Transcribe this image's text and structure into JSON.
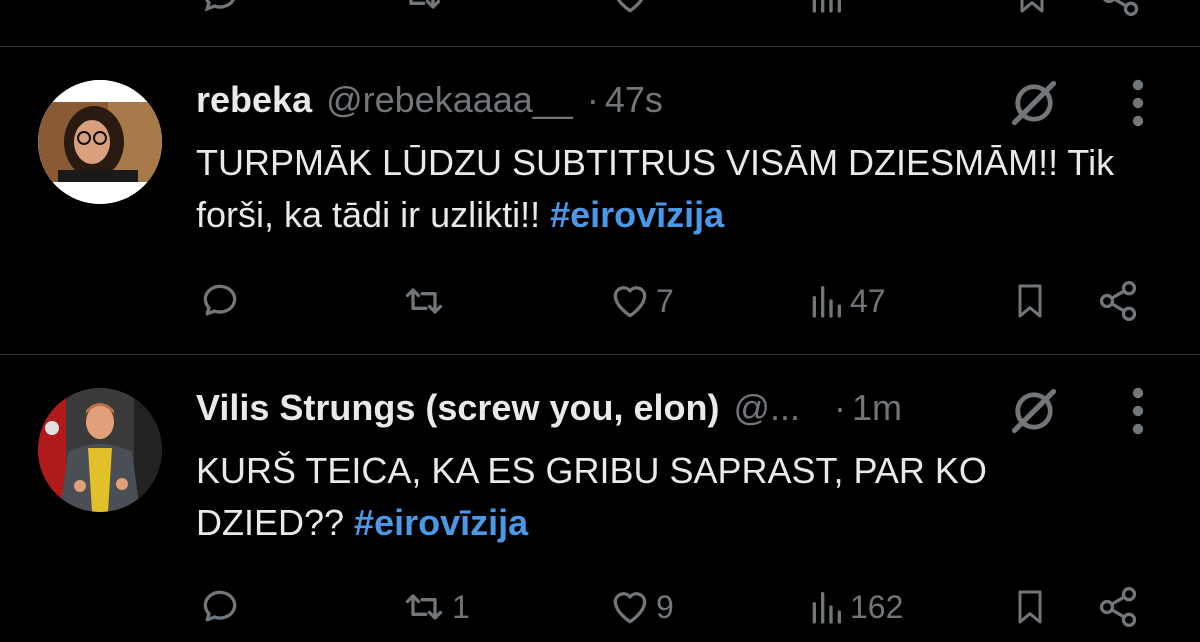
{
  "tweets": [
    {
      "name": "rebeka",
      "handle": "@rebekaaaa__",
      "dot": "·",
      "time": "47s",
      "text_parts": [
        "TURPMĀK LŪDZU SUBTITRUS VISĀM DZIESMĀM!! Tik forši, ka tādi ir uzlikti!! "
      ],
      "hashtag": "#eirovīzija",
      "replies": "",
      "retweets": "",
      "likes": "7",
      "views": "47"
    },
    {
      "name": "Vilis Strungs (screw you, elon)",
      "handle": "@...",
      "dot": "·",
      "time": "1m",
      "text_parts": [
        "KURŠ TEICA, KA ES GRIBU SAPRAST, PAR KO DZIED?? "
      ],
      "hashtag": "#eirovīzija",
      "replies": "",
      "retweets": "1",
      "likes": "9",
      "views": "162"
    }
  ],
  "icons": {
    "reply": "reply-icon",
    "retweet": "retweet-icon",
    "like": "heart-icon",
    "views": "views-icon",
    "bookmark": "bookmark-icon",
    "share": "share-icon",
    "grok": "grok-icon",
    "more": "more-icon"
  },
  "colors": {
    "background": "#000000",
    "text": "#e7e9ea",
    "muted": "#71767b",
    "hashtag": "#4a99e9",
    "divider": "#2f3336"
  }
}
